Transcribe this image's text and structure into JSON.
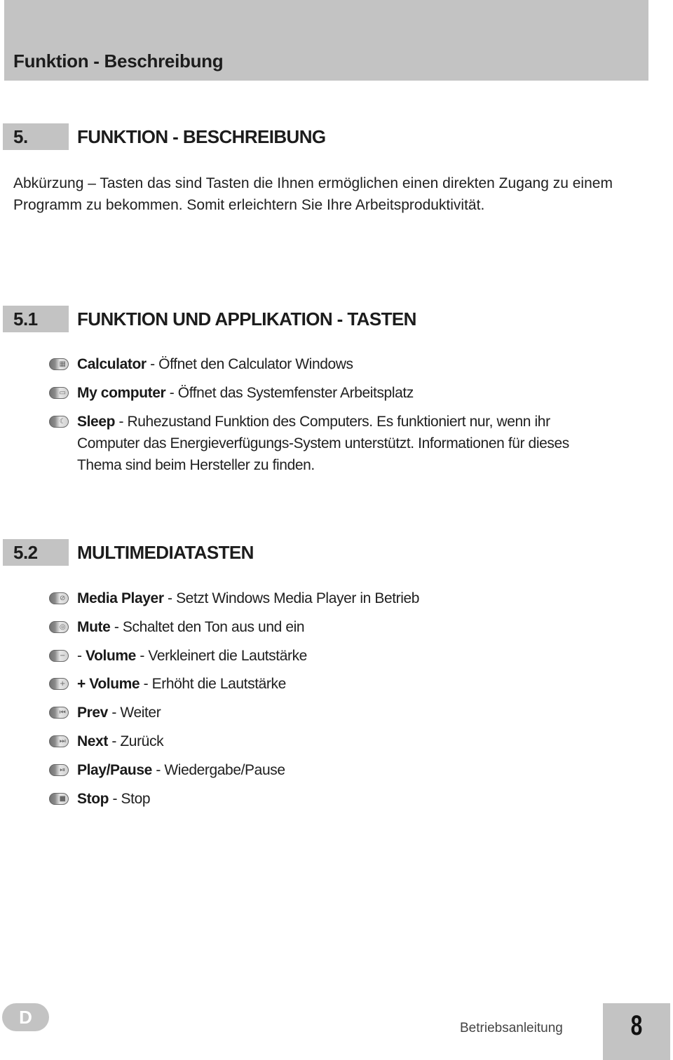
{
  "header": {
    "title": "Funktion - Beschreibung"
  },
  "section5": {
    "number": "5.",
    "title": "FUNKTION - BESCHREIBUNG",
    "intro": "Abkürzung – Tasten das sind Tasten die Ihnen ermöglichen einen direkten Zugang zu einem Programm zu bekommen. Somit erleichtern Sie Ihre Arbeitsproduktivität."
  },
  "section51": {
    "number": "5.1",
    "title": "FUNKTION UND APPLIKATION - TASTEN",
    "items": [
      {
        "icon": "calculator-key-icon",
        "glyph": "▦",
        "label": "Calculator",
        "desc": " - Öffnet den Calculator Windows"
      },
      {
        "icon": "my-computer-key-icon",
        "glyph": "▭",
        "label": "My computer",
        "desc": " - Öffnet das Systemfenster Arbeitsplatz"
      },
      {
        "icon": "sleep-key-icon",
        "glyph": "☾",
        "label": "Sleep",
        "desc": " - Ruhezustand Funktion des Computers. Es funktioniert nur, wenn ihr Computer das Energieverfügungs-System unterstützt. Informationen für dieses Thema sind beim Hersteller zu finden."
      }
    ]
  },
  "section52": {
    "number": "5.2",
    "title": "MULTIMEDIATASTEN",
    "items": [
      {
        "icon": "media-player-key-icon",
        "glyph": "⊘",
        "label": "Media Player",
        "desc": "  - Setzt Windows Media Player in Betrieb"
      },
      {
        "icon": "mute-key-icon",
        "glyph": "◎",
        "label": "Mute",
        "desc": "  -  Schaltet den Ton aus und ein"
      },
      {
        "icon": "volume-down-key-icon",
        "glyph": "−",
        "prefix": "- ",
        "label": "Volume",
        "desc": " - Verkleinert die Lautstärke"
      },
      {
        "icon": "volume-up-key-icon",
        "glyph": "+",
        "label": "+ Volume",
        "desc": " - Erhöht die Lautstärke"
      },
      {
        "icon": "prev-key-icon",
        "glyph": "⏮",
        "label": "Prev",
        "desc": "  - Weiter"
      },
      {
        "icon": "next-key-icon",
        "glyph": "⏭",
        "label": "Next",
        "desc": " - Zurück"
      },
      {
        "icon": "play-pause-key-icon",
        "glyph": "⏯",
        "label": "Play/Pause",
        "desc": " - Wiedergabe/Pause"
      },
      {
        "icon": "stop-key-icon",
        "glyph": "■",
        "label": "Stop",
        "desc": " -  Stop"
      }
    ]
  },
  "footer": {
    "language": "D",
    "label": "Betriebsanleitung",
    "page": "8"
  }
}
